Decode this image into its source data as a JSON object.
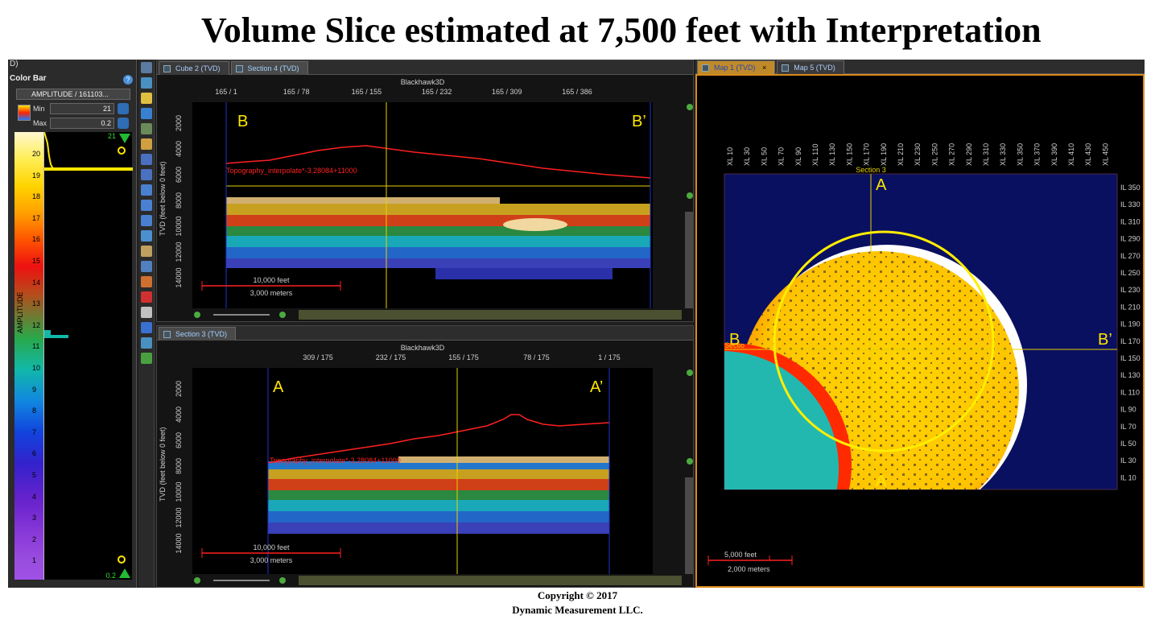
{
  "title": "Volume Slice estimated at 7,500 feet with Interpretation",
  "copyright": {
    "line1": "Copyright  © 2017",
    "line2": "Dynamic Measurement LLC."
  },
  "color_bar": {
    "header": "D)",
    "title": "Color Bar",
    "attribute": "AMPLITUDE / 161103...",
    "min_label": "Min",
    "min_value": "21",
    "max_label": "Max",
    "max_value": "0.2",
    "axis_label": "AMPLITUDE",
    "ticks": [
      "20",
      "19",
      "18",
      "17",
      "16",
      "15",
      "14",
      "13",
      "12",
      "11",
      "10",
      "9",
      "8",
      "7",
      "6",
      "5",
      "4",
      "3",
      "2",
      "1"
    ],
    "top_marker": "21",
    "bottom_marker": "0.2"
  },
  "top_section": {
    "tabs": [
      "Cube 2 (TVD)",
      "Section 4 (TVD)"
    ],
    "survey": "Blackhawk3D",
    "x_ticks": [
      "165 / 1",
      "165 / 78",
      "165 / 155",
      "165 / 232",
      "165 / 309",
      "165 / 386"
    ],
    "y_label": "TVD (feet below 0 feet)",
    "y_ticks": [
      "2000",
      "4000",
      "6000",
      "8000",
      "10000",
      "12000",
      "14000"
    ],
    "left_marker": "B",
    "right_marker": "B’",
    "horizon_label": "Topography_interpolate*-3.28084+11000",
    "scale_feet": "10,000 feet",
    "scale_meters": "3,000 meters"
  },
  "bottom_section": {
    "tabs": [
      "Section 3 (TVD)"
    ],
    "survey": "Blackhawk3D",
    "x_ticks": [
      "309 / 175",
      "232 / 175",
      "155 / 175",
      "78 / 175",
      "1 / 175"
    ],
    "y_label": "TVD (feet below 0 feet)",
    "y_ticks": [
      "2000",
      "4000",
      "6000",
      "8000",
      "10000",
      "12000",
      "14000"
    ],
    "left_marker": "A",
    "right_marker": "A’",
    "horizon_label": "Topography_interpolate*-3.28084+11000",
    "scale_feet": "10,000 feet",
    "scale_meters": "3,000 meters"
  },
  "map": {
    "tabs": [
      "Map 1 (TVD)",
      "Map 5 (TVD)"
    ],
    "xl_ticks": [
      "XL 10",
      "XL 30",
      "XL 50",
      "XL 70",
      "XL 90",
      "XL 110",
      "XL 130",
      "XL 150",
      "XL 170",
      "XL 190",
      "XL 210",
      "XL 230",
      "XL 250",
      "XL 270",
      "XL 290",
      "XL 310",
      "XL 330",
      "XL 350",
      "XL 370",
      "XL 390",
      "XL 410",
      "XL 430",
      "XL 450"
    ],
    "il_ticks": [
      "IL 350",
      "IL 330",
      "IL 310",
      "IL 290",
      "IL 270",
      "IL 250",
      "IL 230",
      "IL 210",
      "IL 190",
      "IL 170",
      "IL 150",
      "IL 130",
      "IL 110",
      "IL 90",
      "IL 70",
      "IL 50",
      "IL 30",
      "IL 10"
    ],
    "section3_label": "Section 3",
    "section4_label": "Sectio",
    "marker_a": "A",
    "marker_a_bottom": "A",
    "marker_b": "B",
    "marker_b_right": "B’",
    "scale_feet": "5,000 feet",
    "scale_meters": "2,000 meters"
  },
  "colors": {
    "marker": "#ffe600",
    "horizon": "#ff2020",
    "map_background": "#0a1060",
    "frame": "#d98a1a"
  }
}
